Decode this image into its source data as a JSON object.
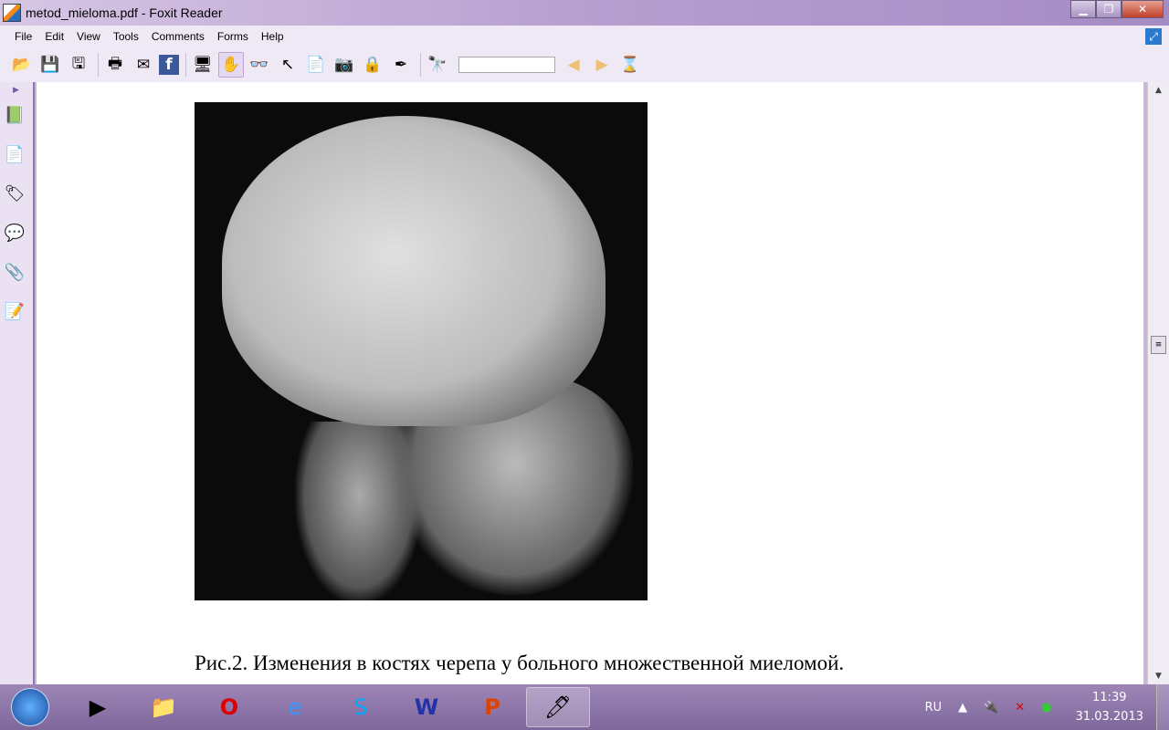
{
  "window": {
    "title": "metod_mieloma.pdf - Foxit Reader"
  },
  "menu": [
    "File",
    "Edit",
    "View",
    "Tools",
    "Comments",
    "Forms",
    "Help"
  ],
  "toolbar": {
    "search_value": ""
  },
  "document": {
    "caption": "Рис.2. Изменения в костях черепа у больного множественной миеломой."
  },
  "taskbar": {
    "apps": [
      "Windows Media Player",
      "Windows Explorer",
      "Opera",
      "Internet Explorer",
      "Skype",
      "Microsoft Word",
      "PowerPoint",
      "Foxit Reader"
    ]
  },
  "tray": {
    "language": "RU",
    "time": "11:39",
    "date": "31.03.2013"
  }
}
